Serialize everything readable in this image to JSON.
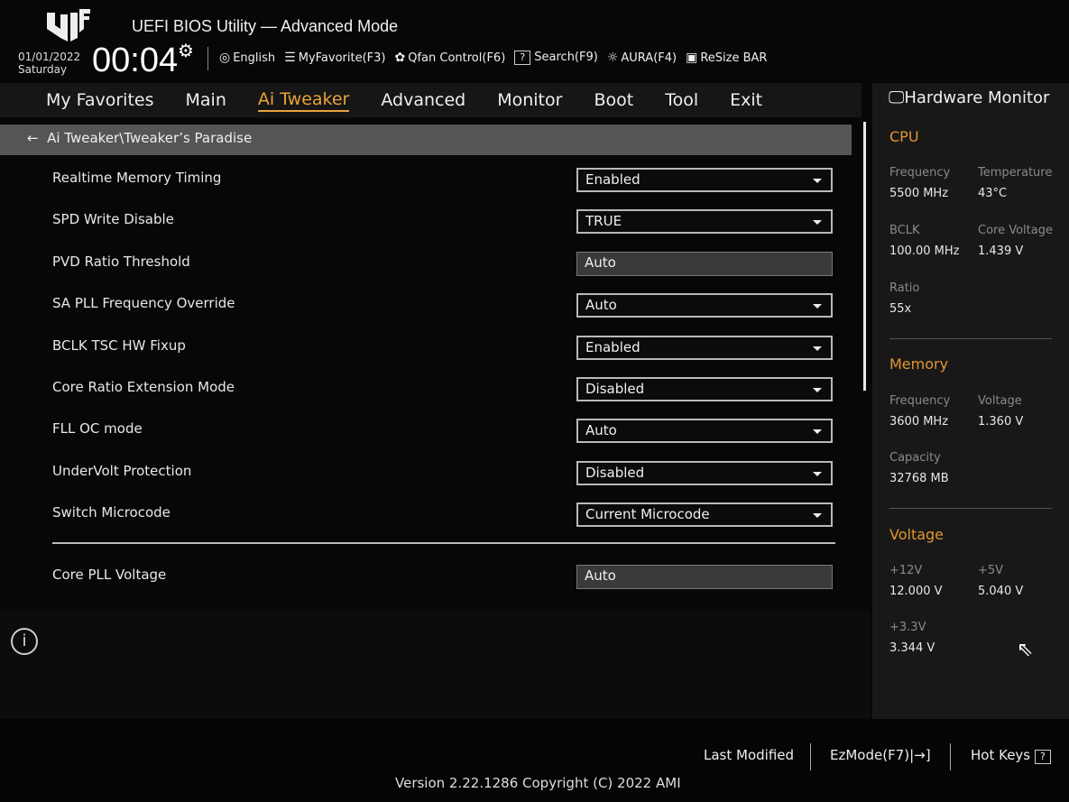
{
  "header": {
    "title": "UEFI BIOS Utility — Advanced Mode",
    "date": "01/01/2022",
    "day": "Saturday",
    "time": "00:04"
  },
  "toolbar": [
    {
      "icon": "globe-icon",
      "glyph": "🌐",
      "label": "English"
    },
    {
      "icon": "favorite-icon",
      "glyph": "☰",
      "label": "MyFavorite(F3)"
    },
    {
      "icon": "fan-icon",
      "glyph": "✿",
      "label": "Qfan Control(F6)"
    },
    {
      "icon": "search-help-icon",
      "glyph": "?",
      "label": "Search(F9)"
    },
    {
      "icon": "aura-icon",
      "glyph": "☼",
      "label": "AURA(F4)"
    },
    {
      "icon": "resize-bar-icon",
      "glyph": "▣",
      "label": "ReSize BAR"
    }
  ],
  "nav": {
    "tabs": [
      "My Favorites",
      "Main",
      "Ai Tweaker",
      "Advanced",
      "Monitor",
      "Boot",
      "Tool",
      "Exit"
    ],
    "active": "Ai Tweaker"
  },
  "breadcrumb": "Ai Tweaker\\Tweaker’s Paradise",
  "settings": [
    {
      "label": "Realtime Memory Timing",
      "value": "Enabled",
      "type": "dropdown"
    },
    {
      "label": "SPD Write Disable",
      "value": "TRUE",
      "type": "dropdown"
    },
    {
      "label": "PVD Ratio Threshold",
      "value": "Auto",
      "type": "input"
    },
    {
      "label": "SA PLL Frequency Override",
      "value": "Auto",
      "type": "dropdown"
    },
    {
      "label": "BCLK TSC HW Fixup",
      "value": "Enabled",
      "type": "dropdown"
    },
    {
      "label": "Core Ratio Extension Mode",
      "value": "Disabled",
      "type": "dropdown"
    },
    {
      "label": "FLL OC mode",
      "value": "Auto",
      "type": "dropdown"
    },
    {
      "label": "UnderVolt Protection",
      "value": "Disabled",
      "type": "dropdown"
    },
    {
      "label": "Switch Microcode",
      "value": "Current Microcode",
      "type": "dropdown"
    },
    {
      "label": "Core PLL Voltage",
      "value": "Auto",
      "type": "input"
    }
  ],
  "hw": {
    "title": "Hardware Monitor",
    "cpu": {
      "title": "CPU",
      "freq_k": "Frequency",
      "freq": "5500 MHz",
      "temp_k": "Temperature",
      "temp": "43°C",
      "bclk_k": "BCLK",
      "bclk": "100.00 MHz",
      "cv_k": "Core Voltage",
      "cv": "1.439 V",
      "ratio_k": "Ratio",
      "ratio": "55x"
    },
    "mem": {
      "title": "Memory",
      "freq_k": "Frequency",
      "freq": "3600 MHz",
      "volt_k": "Voltage",
      "volt": "1.360 V",
      "cap_k": "Capacity",
      "cap": "32768 MB"
    },
    "volt": {
      "title": "Voltage",
      "v12_k": "+12V",
      "v12": "12.000 V",
      "v5_k": "+5V",
      "v5": "5.040 V",
      "v33_k": "+3.3V",
      "v33": "3.344 V"
    }
  },
  "footer": {
    "last_modified": "Last Modified",
    "ezmode": "EzMode(F7)|→]",
    "hotkeys": "Hot Keys",
    "version": "Version 2.22.1286 Copyright (C) 2022 AMI"
  },
  "colors": {
    "accent": "#e9a23b"
  }
}
